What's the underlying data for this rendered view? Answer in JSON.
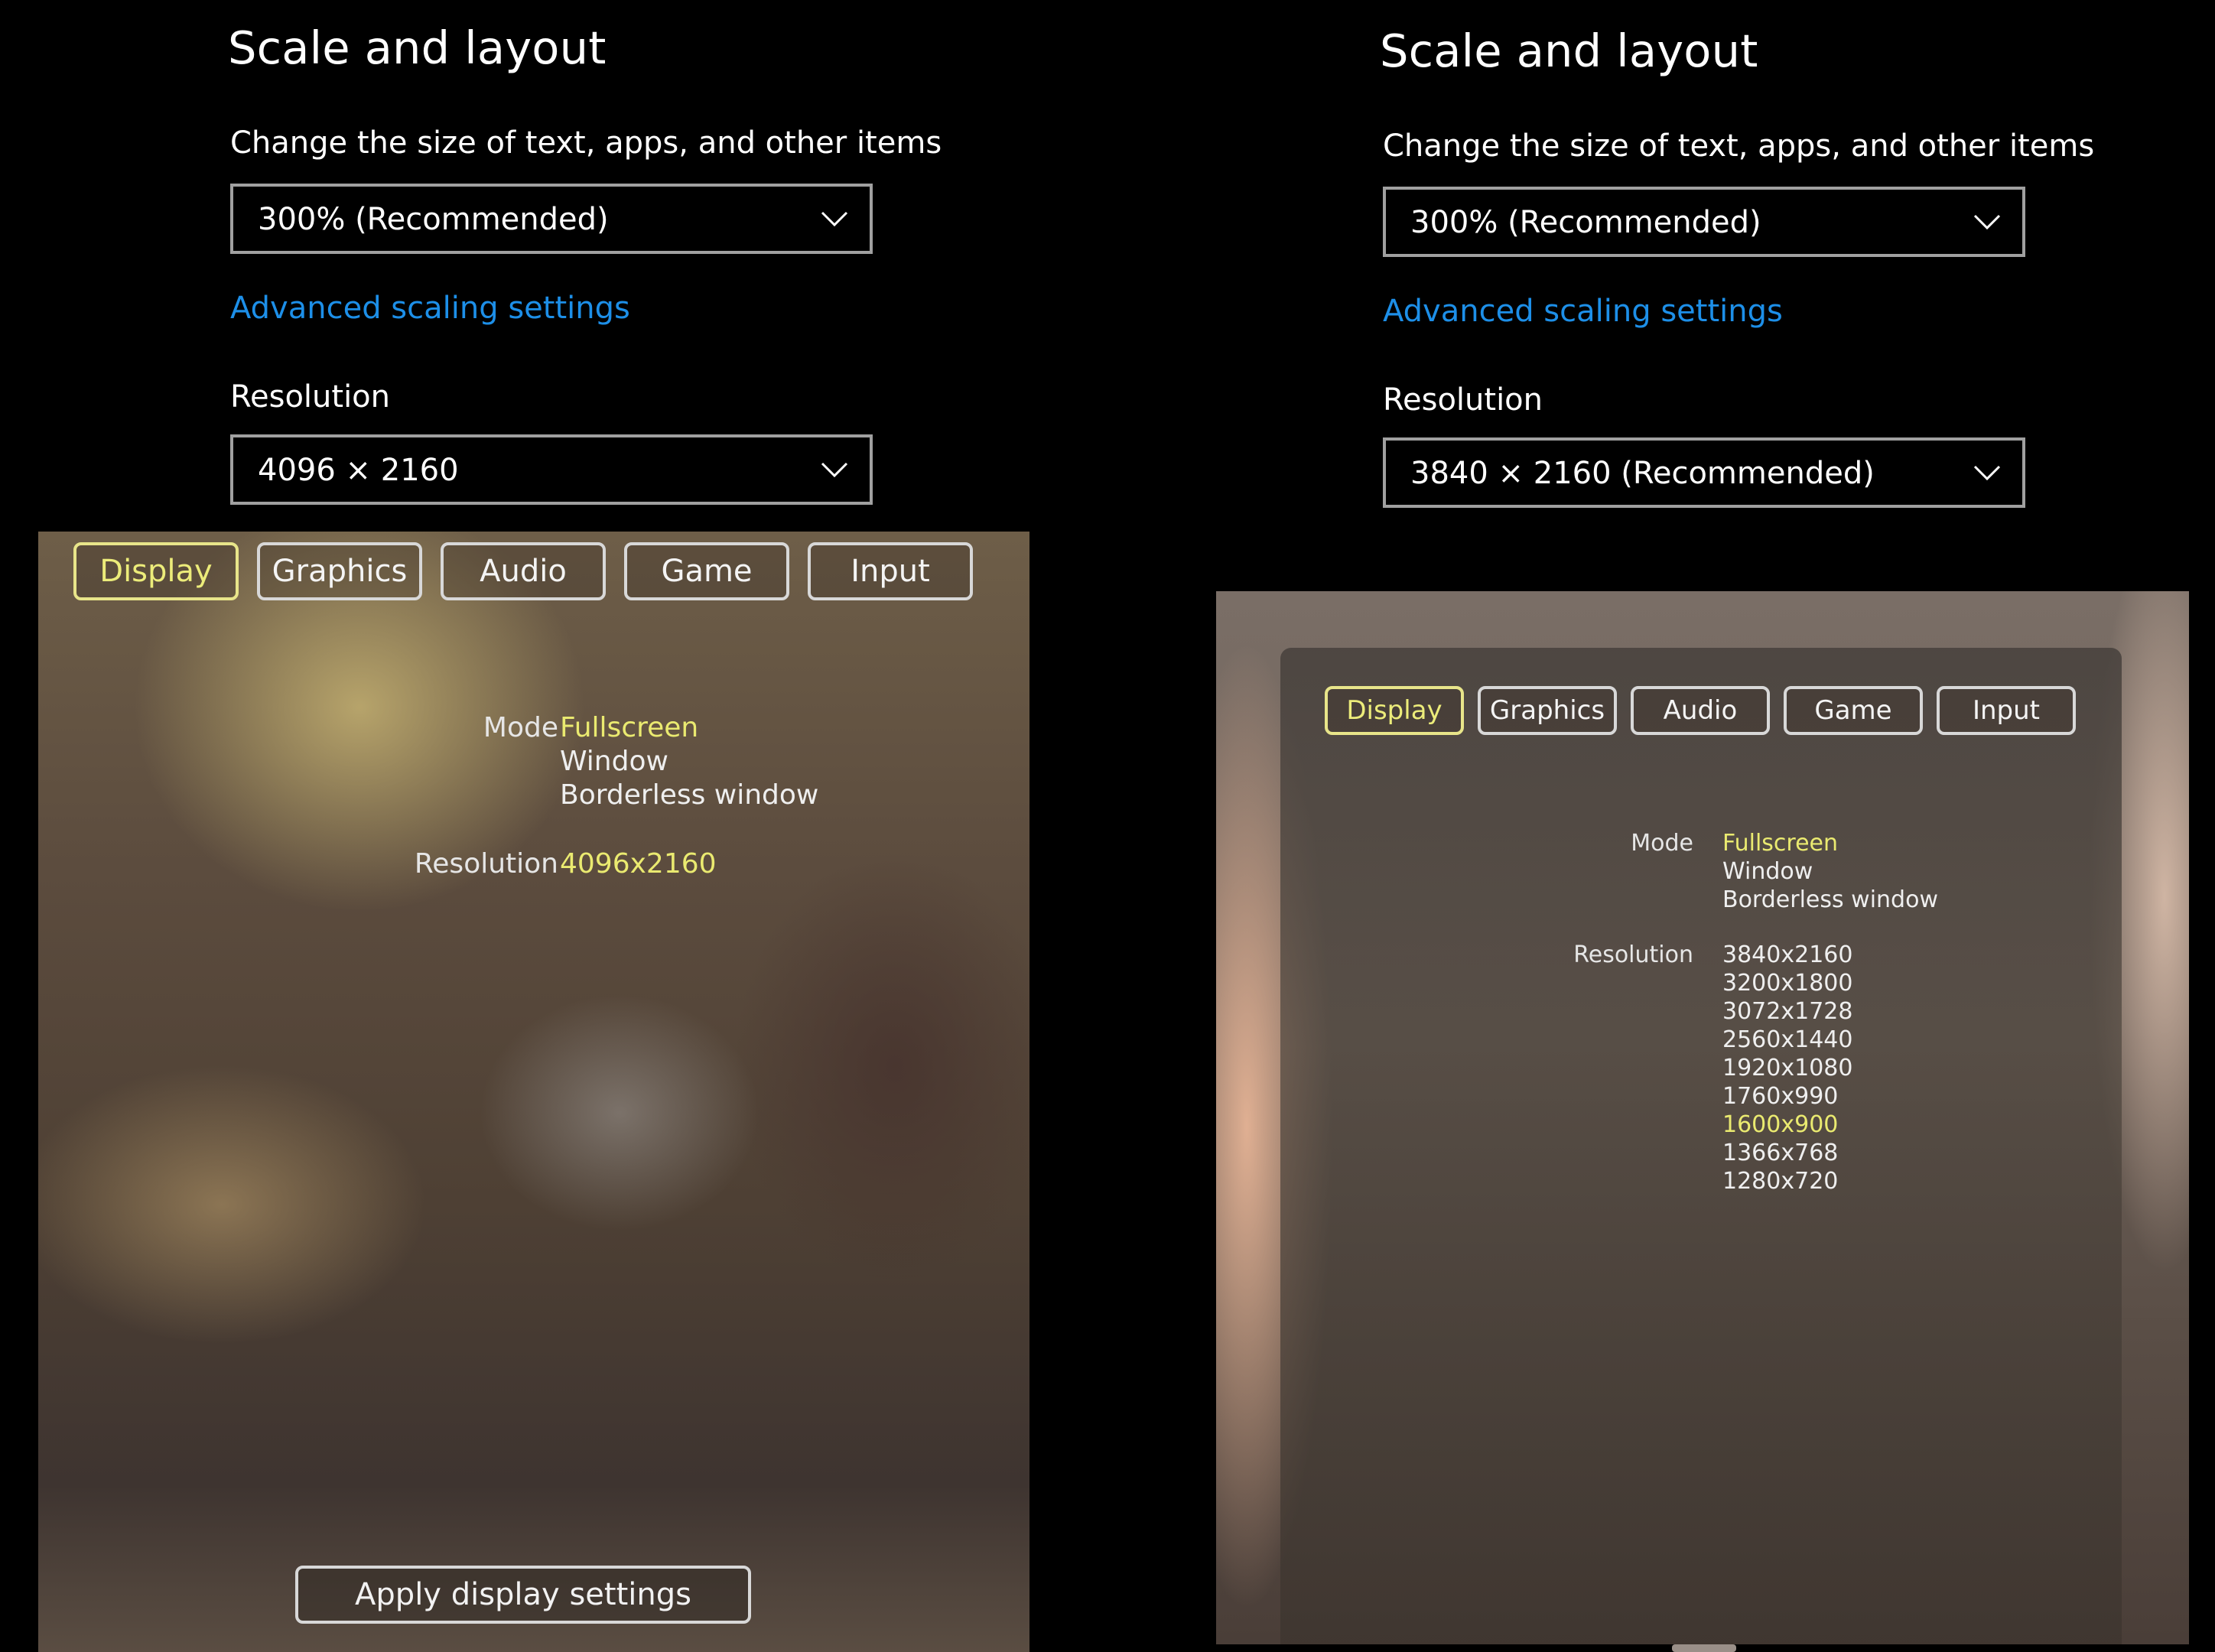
{
  "left": {
    "windows_settings": {
      "title": "Scale and layout",
      "scale_label": "Change the size of text, apps, and other items",
      "scale_value": "300% (Recommended)",
      "advanced_link": "Advanced scaling settings",
      "resolution_label": "Resolution",
      "resolution_value": "4096 × 2160"
    },
    "game": {
      "tabs": [
        "Display",
        "Graphics",
        "Audio",
        "Game",
        "Input"
      ],
      "active_tab": "Display",
      "mode_label": "Mode",
      "mode_options": [
        "Fullscreen",
        "Window",
        "Borderless window"
      ],
      "mode_selected": "Fullscreen",
      "resolution_label": "Resolution",
      "resolution_options": [
        "4096x2160"
      ],
      "resolution_selected": "4096x2160",
      "apply_button": "Apply display settings"
    }
  },
  "right": {
    "windows_settings": {
      "title": "Scale and layout",
      "scale_label": "Change the size of text, apps, and other items",
      "scale_value": "300% (Recommended)",
      "advanced_link": "Advanced scaling settings",
      "resolution_label": "Resolution",
      "resolution_value": "3840 × 2160 (Recommended)"
    },
    "game": {
      "tabs": [
        "Display",
        "Graphics",
        "Audio",
        "Game",
        "Input"
      ],
      "active_tab": "Display",
      "mode_label": "Mode",
      "mode_options": [
        "Fullscreen",
        "Window",
        "Borderless window"
      ],
      "mode_selected": "Fullscreen",
      "resolution_label": "Resolution",
      "resolution_options": [
        "3840x2160",
        "3200x1800",
        "3072x1728",
        "2560x1440",
        "1920x1080",
        "1760x990",
        "1600x900",
        "1366x768",
        "1280x720"
      ],
      "resolution_selected": "1600x900"
    }
  },
  "colors": {
    "link_blue": "#1d8fe8",
    "selected_yellow": "#eaea70",
    "select_border": "#a0a0a0"
  }
}
